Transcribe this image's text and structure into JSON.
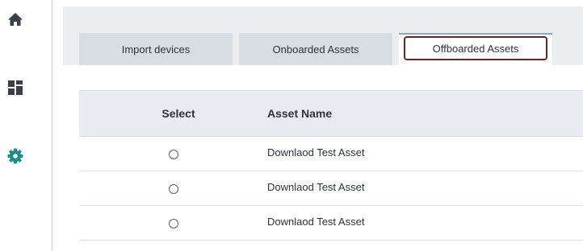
{
  "sidebar": {
    "icons": [
      {
        "name": "home-icon"
      },
      {
        "name": "dashboard-icon"
      },
      {
        "name": "gear-icon",
        "color": "#1a8c8c"
      }
    ]
  },
  "tabs": [
    {
      "label": "Import devices",
      "active": false
    },
    {
      "label": "Onboarded Assets",
      "active": false
    },
    {
      "label": "Offboarded Assets",
      "active": true
    }
  ],
  "table": {
    "columns": [
      "Select",
      "Asset Name"
    ],
    "rows": [
      {
        "selected": false,
        "asset_name": "Downlaod Test Asset"
      },
      {
        "selected": false,
        "asset_name": "Downlaod Test Asset"
      },
      {
        "selected": false,
        "asset_name": "Downlaod Test Asset"
      }
    ]
  },
  "colors": {
    "accent": "#1a8c8c",
    "active_tab_outline": "#7a1f1f",
    "header_bg": "#e8ecf0"
  }
}
